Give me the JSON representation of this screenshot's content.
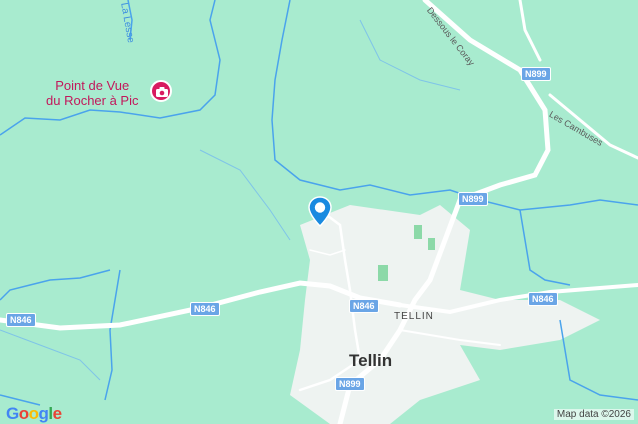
{
  "map": {
    "poi": {
      "name_line1": "Point de Vue",
      "name_line2": "du Rocher à Pic",
      "icon": "camera-icon"
    },
    "water_label": "La Lesse",
    "street_labels": {
      "dessous_le_coray": "Dessous le Coray",
      "les_cambuses": "Les Cambuses"
    },
    "road_shields": {
      "n899_top": "N899",
      "n899_mid": "N899",
      "n899_bottom": "N899",
      "n846_left": "N846",
      "n846_center": "N846",
      "n846_west": "N846",
      "n846_right": "N846"
    },
    "places": {
      "town": "Tellin",
      "locality": "TELLIN"
    },
    "marker": "location-pin-icon",
    "colors": {
      "land": "#a8ebcf",
      "town": "#eef3f1",
      "road": "#ffffff",
      "shield": "#6aa5e6",
      "water": "#4aa3ec",
      "poi": "#d81b60"
    },
    "logo": "Google",
    "attribution": "Map data ©2026"
  }
}
